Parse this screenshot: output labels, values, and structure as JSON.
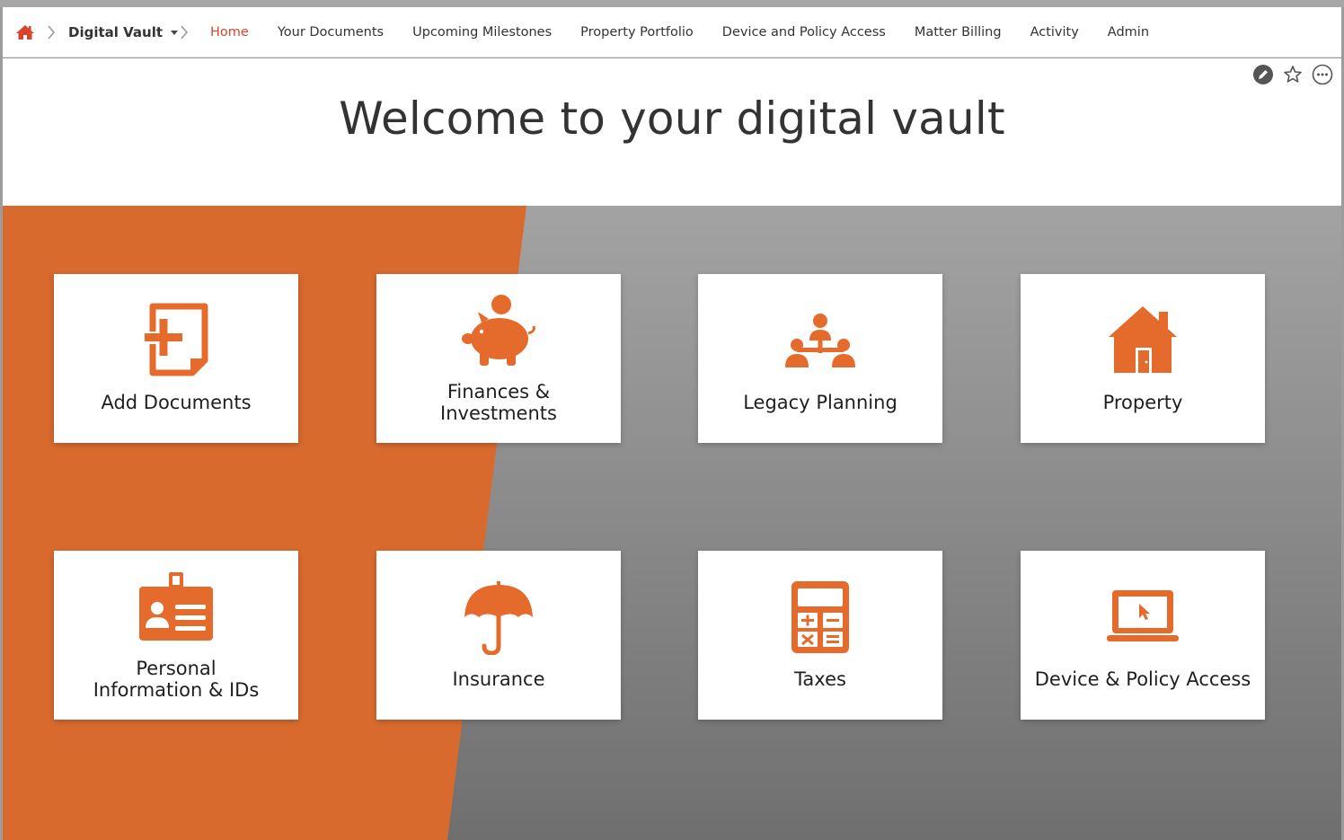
{
  "breadcrumb": {
    "home_icon": "home-icon",
    "vault_label": "Digital Vault"
  },
  "nav": {
    "items": [
      {
        "label": "Home",
        "active": true
      },
      {
        "label": "Your Documents"
      },
      {
        "label": "Upcoming Milestones"
      },
      {
        "label": "Property Portfolio"
      },
      {
        "label": "Device and Policy Access"
      },
      {
        "label": "Matter Billing"
      },
      {
        "label": "Activity"
      },
      {
        "label": "Admin"
      }
    ]
  },
  "page": {
    "title": "Welcome to your digital vault",
    "toolbar_icons": [
      "edit-icon",
      "star-icon",
      "more-icon"
    ]
  },
  "tiles": [
    {
      "label": "Add Documents",
      "icon": "add-document-icon"
    },
    {
      "label": "Finances &\nInvestments",
      "icon": "piggy-bank-icon"
    },
    {
      "label": "Legacy Planning",
      "icon": "family-tree-icon"
    },
    {
      "label": "Property",
      "icon": "house-icon"
    },
    {
      "label": "Personal\nInformation & IDs",
      "icon": "id-card-icon"
    },
    {
      "label": "Insurance",
      "icon": "umbrella-icon"
    },
    {
      "label": "Taxes",
      "icon": "calculator-icon"
    },
    {
      "label": "Device & Policy Access",
      "icon": "laptop-icon"
    }
  ],
  "colors": {
    "accent": "#e46b2c",
    "active_nav": "#d9442f",
    "background_orange": "#d86a2e",
    "background_gray": "#8e8e8e"
  }
}
